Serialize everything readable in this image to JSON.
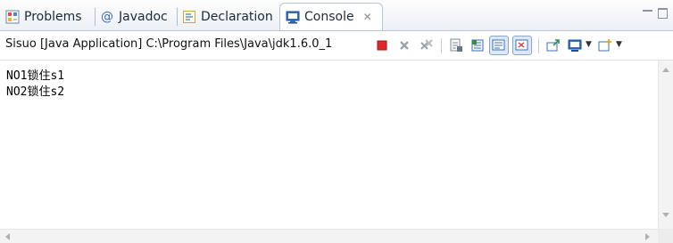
{
  "tabs": [
    {
      "label": "Problems",
      "icon": "problems-icon"
    },
    {
      "label": "Javadoc",
      "icon": "at-icon"
    },
    {
      "label": "Declaration",
      "icon": "declaration-icon"
    },
    {
      "label": "Console",
      "icon": "console-icon",
      "active": true,
      "close_glyph": "✕"
    }
  ],
  "console_title": "Sisuo [Java Application] C:\\Program Files\\Java\\jdk1.6.0_1",
  "output_lines": [
    "NO1锁住s1",
    "NO2锁住s2"
  ],
  "toolbar_icons": [
    "terminate-icon",
    "remove-launch-icon",
    "remove-all-terminated-icon",
    "clear-console-icon",
    "scroll-lock-icon",
    "word-wrap-icon",
    "show-on-stdout-icon",
    "pin-console-icon",
    "display-console-icon",
    "open-console-icon"
  ],
  "colors": {
    "accent": "#3a69a7",
    "terminate": "#e0272e",
    "tab_border": "#b9c4d2"
  }
}
